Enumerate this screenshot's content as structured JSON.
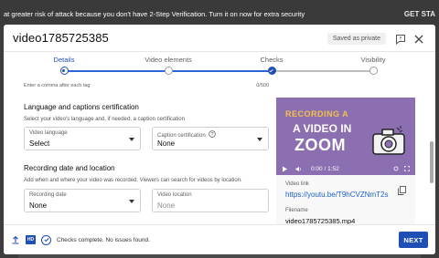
{
  "banner": {
    "text": "at greater risk of attack because you don't have 2-Step Verification. Turn it on now for extra security",
    "action": "GET STA"
  },
  "dialog": {
    "title": "video1785725385",
    "saved_badge": "Saved as private",
    "icons": {
      "feedback": "feedback-icon",
      "close": "close-icon"
    }
  },
  "stepper": {
    "steps": [
      {
        "label": "Details",
        "state": "current"
      },
      {
        "label": "Video elements",
        "state": "todo"
      },
      {
        "label": "Checks",
        "state": "done"
      },
      {
        "label": "Visibility",
        "state": "todo"
      }
    ]
  },
  "tags": {
    "hint": "Enter a comma after each tag",
    "count": "0/500"
  },
  "language": {
    "title": "Language and captions certification",
    "desc": "Select your video's language and, if needed, a caption certification",
    "video_language": {
      "label": "Video language",
      "value": "Select"
    },
    "caption_cert": {
      "label": "Caption certification",
      "value": "None"
    }
  },
  "recording": {
    "title": "Recording date and location",
    "desc": "Add when and where your video was recorded. Viewers can search for videos by location.",
    "date": {
      "label": "Recording date",
      "value": "None"
    },
    "location": {
      "label": "Video location",
      "placeholder": "None"
    }
  },
  "preview": {
    "thumb_line1": "RECORDING A",
    "thumb_line2": "A VIDEO IN",
    "thumb_line3": "ZOOM",
    "time": "0:00 / 1:52",
    "link_label": "Video link",
    "link": "https://youtu.be/T9hCVZNmT2s",
    "filename_label": "Filename",
    "filename": "video1785725385.mp4"
  },
  "footer": {
    "status": "Checks complete. No issues found.",
    "hd": "HD",
    "next": "NEXT"
  },
  "colors": {
    "accent": "#1f4fb5",
    "thumb_bg": "#8c6fb0"
  }
}
